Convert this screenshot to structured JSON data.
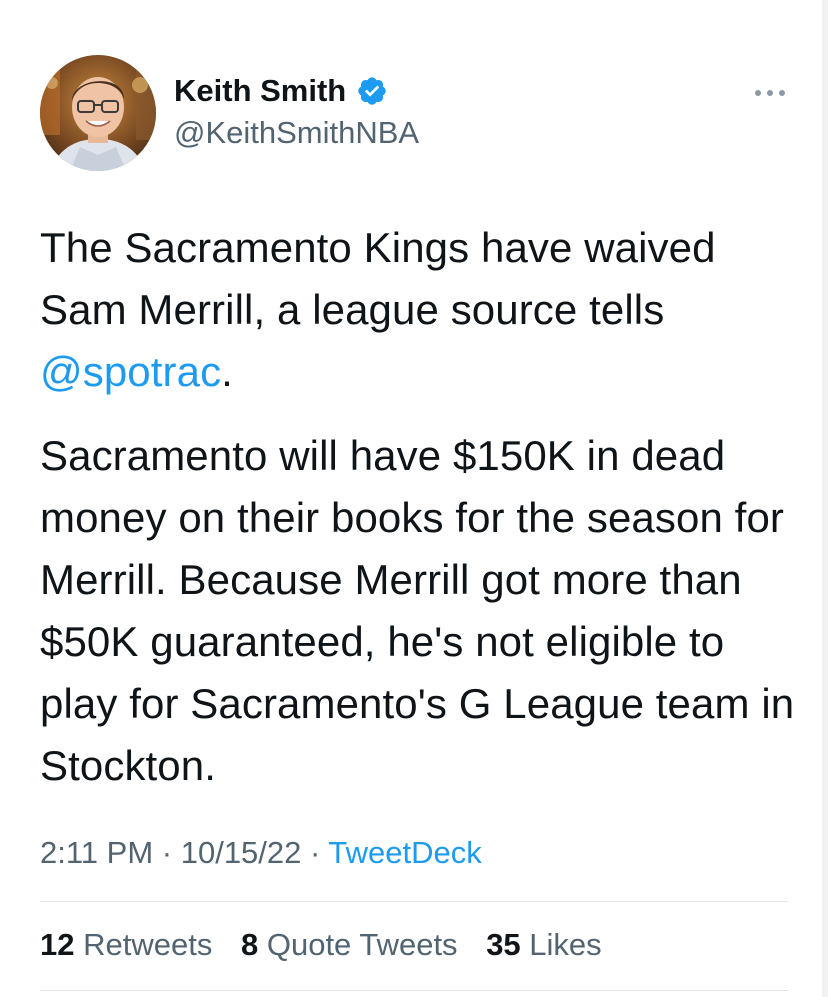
{
  "author": {
    "display_name": "Keith Smith",
    "handle": "@KeithSmithNBA",
    "verified": true,
    "verified_color": "#1d9bf0"
  },
  "menu": {
    "icon": "more-horizontal-icon"
  },
  "tweet": {
    "paragraph1_text": "The Sacramento Kings have waived Sam Merrill, a league source tells ",
    "mention": "@spotrac",
    "paragraph1_end": ".",
    "paragraph2": "Sacramento will have $150K in dead money on their books for the season for Merrill. Because Merrill got more than $50K guaranteed, he's not eligible to play for Sacramento's G League team in Stockton."
  },
  "meta": {
    "time": "2:11 PM",
    "separator": " · ",
    "date": "10/15/22",
    "source": "TweetDeck"
  },
  "engagement": {
    "retweets_count": "12",
    "retweets_label": "Retweets",
    "quotes_count": "8",
    "quotes_label": "Quote Tweets",
    "likes_count": "35",
    "likes_label": "Likes"
  },
  "colors": {
    "text_primary": "#0f1419",
    "text_secondary": "#536471",
    "link": "#1d9bf0",
    "divider": "#e1e6ea"
  }
}
